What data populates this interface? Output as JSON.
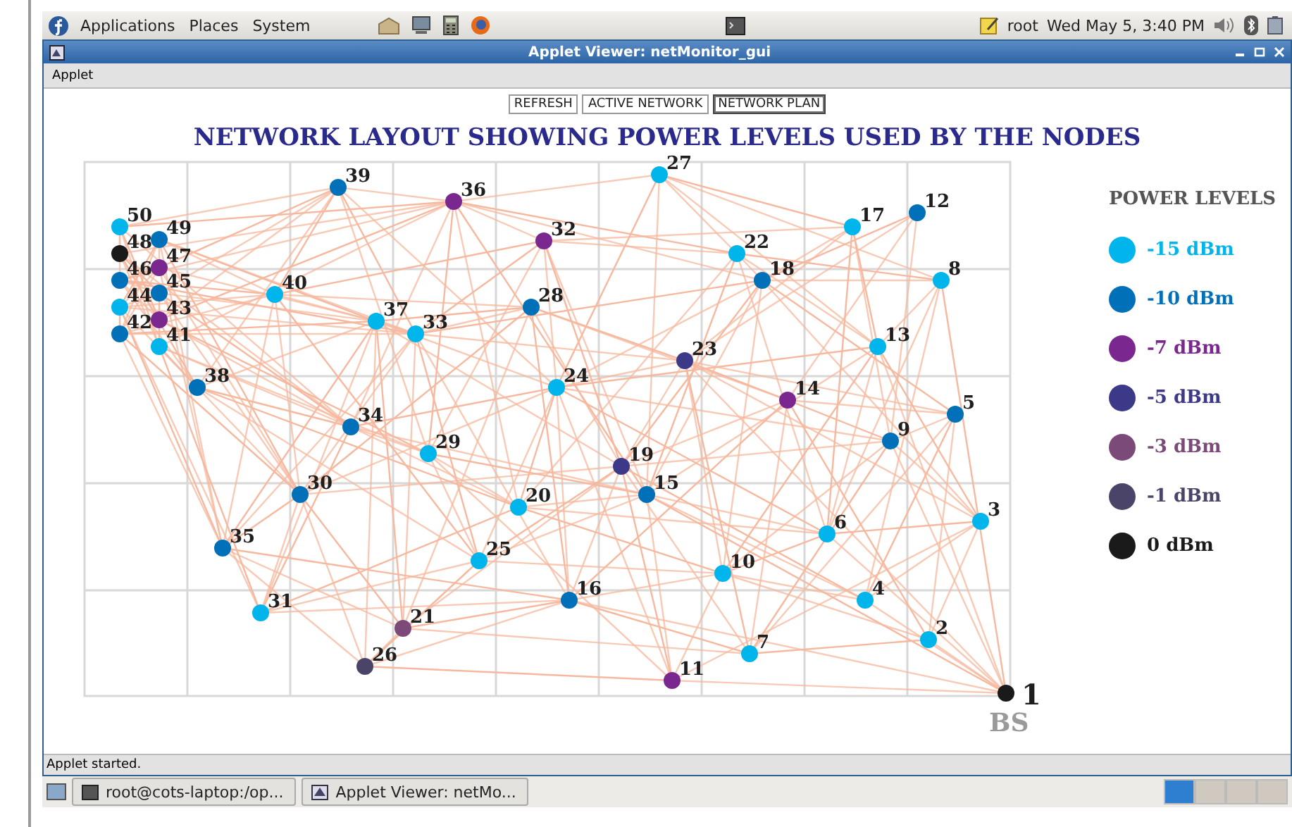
{
  "desktop_panel": {
    "menus": [
      "Applications",
      "Places",
      "System"
    ],
    "user": "root",
    "clock": "Wed May  5,  3:40 PM"
  },
  "window": {
    "title": "Applet Viewer: netMonitor_gui"
  },
  "menu_bar": [
    "Applet"
  ],
  "view_buttons": [
    {
      "label": "REFRESH",
      "selected": false
    },
    {
      "label": "ACTIVE NETWORK",
      "selected": false
    },
    {
      "label": "NETWORK PLAN",
      "selected": true
    }
  ],
  "chart_title": "NETWORK LAYOUT SHOWING POWER LEVELS USED BY THE NODES",
  "nodes": [
    {
      "label": "1",
      "kind": "base_station",
      "color": "#1a1a1a"
    },
    {
      "label": "2",
      "kind": "node",
      "color": "#00b4ec"
    },
    {
      "label": "3",
      "kind": "node",
      "color": "#00b4ec"
    },
    {
      "label": "4",
      "kind": "node",
      "color": "#00b4ec"
    },
    {
      "label": "5",
      "kind": "node",
      "color": "#0070b8"
    },
    {
      "label": "6",
      "kind": "node",
      "color": "#00b4ec"
    },
    {
      "label": "7",
      "kind": "node",
      "color": "#00b4ec"
    },
    {
      "label": "8",
      "kind": "node",
      "color": "#00b4ec"
    },
    {
      "label": "9",
      "kind": "node",
      "color": "#0070b8"
    },
    {
      "label": "10",
      "kind": "node",
      "color": "#00b4ec"
    },
    {
      "label": "11",
      "kind": "node",
      "color": "#7a2890"
    },
    {
      "label": "12",
      "kind": "node",
      "color": "#0070b8"
    },
    {
      "label": "13",
      "kind": "node",
      "color": "#00b4ec"
    },
    {
      "label": "14",
      "kind": "node",
      "color": "#7a2890"
    },
    {
      "label": "15",
      "kind": "node",
      "color": "#0070b8"
    },
    {
      "label": "16",
      "kind": "node",
      "color": "#0070b8"
    },
    {
      "label": "17",
      "kind": "node",
      "color": "#00b4ec"
    },
    {
      "label": "18",
      "kind": "node",
      "color": "#0070b8"
    },
    {
      "label": "19",
      "kind": "node",
      "color": "#3c3a88"
    },
    {
      "label": "20",
      "kind": "node",
      "color": "#00b4ec"
    },
    {
      "label": "21",
      "kind": "node",
      "color": "#7c4a78"
    },
    {
      "label": "22",
      "kind": "node",
      "color": "#00b4ec"
    },
    {
      "label": "23",
      "kind": "node",
      "color": "#3c3a88"
    },
    {
      "label": "24",
      "kind": "node",
      "color": "#00b4ec"
    },
    {
      "label": "25",
      "kind": "node",
      "color": "#00b4ec"
    },
    {
      "label": "26",
      "kind": "node",
      "color": "#4a4468"
    },
    {
      "label": "27",
      "kind": "node",
      "color": "#00b4ec"
    },
    {
      "label": "28",
      "kind": "node",
      "color": "#0070b8"
    },
    {
      "label": "29",
      "kind": "node",
      "color": "#00b4ec"
    },
    {
      "label": "30",
      "kind": "node",
      "color": "#0070b8"
    },
    {
      "label": "31",
      "kind": "node",
      "color": "#00b4ec"
    },
    {
      "label": "32",
      "kind": "node",
      "color": "#7a2890"
    },
    {
      "label": "33",
      "kind": "node",
      "color": "#00b4ec"
    },
    {
      "label": "34",
      "kind": "node",
      "color": "#0070b8"
    },
    {
      "label": "35",
      "kind": "node",
      "color": "#0070b8"
    },
    {
      "label": "36",
      "kind": "node",
      "color": "#7a2890"
    },
    {
      "label": "37",
      "kind": "node",
      "color": "#00b4ec"
    },
    {
      "label": "38",
      "kind": "node",
      "color": "#0070b8"
    },
    {
      "label": "39",
      "kind": "node",
      "color": "#0070b8"
    },
    {
      "label": "40",
      "kind": "node",
      "color": "#00b4ec"
    },
    {
      "label": "41",
      "kind": "node",
      "color": "#00b4ec"
    },
    {
      "label": "42",
      "kind": "node",
      "color": "#0070b8"
    },
    {
      "label": "43",
      "kind": "node",
      "color": "#7a2890"
    },
    {
      "label": "44",
      "kind": "node",
      "color": "#00b4ec"
    },
    {
      "label": "45",
      "kind": "node",
      "color": "#0070b8"
    },
    {
      "label": "46",
      "kind": "node",
      "color": "#0070b8"
    },
    {
      "label": "47",
      "kind": "node",
      "color": "#7a2890"
    },
    {
      "label": "48",
      "kind": "node",
      "color": "#1a1a1a"
    },
    {
      "label": "49",
      "kind": "node",
      "color": "#0070b8"
    },
    {
      "label": "50",
      "kind": "node",
      "color": "#00b4ec"
    }
  ],
  "base_station_label": "BS",
  "legend": {
    "title": "POWER LEVELS",
    "items": [
      {
        "label": "-15 dBm",
        "color": "#00b4ec"
      },
      {
        "label": "-10 dBm",
        "color": "#0070b8"
      },
      {
        "label": "-7 dBm",
        "color": "#7a2890"
      },
      {
        "label": "-5 dBm",
        "color": "#3c3a88"
      },
      {
        "label": "-3 dBm",
        "color": "#7c4a78"
      },
      {
        "label": "-1 dBm",
        "color": "#4a4468"
      },
      {
        "label": "0 dBm",
        "color": "#1a1a1a"
      }
    ]
  },
  "status_bar": "Applet started.",
  "taskbar": [
    "root@cots-laptop:/op...",
    "Applet Viewer: netMo..."
  ]
}
